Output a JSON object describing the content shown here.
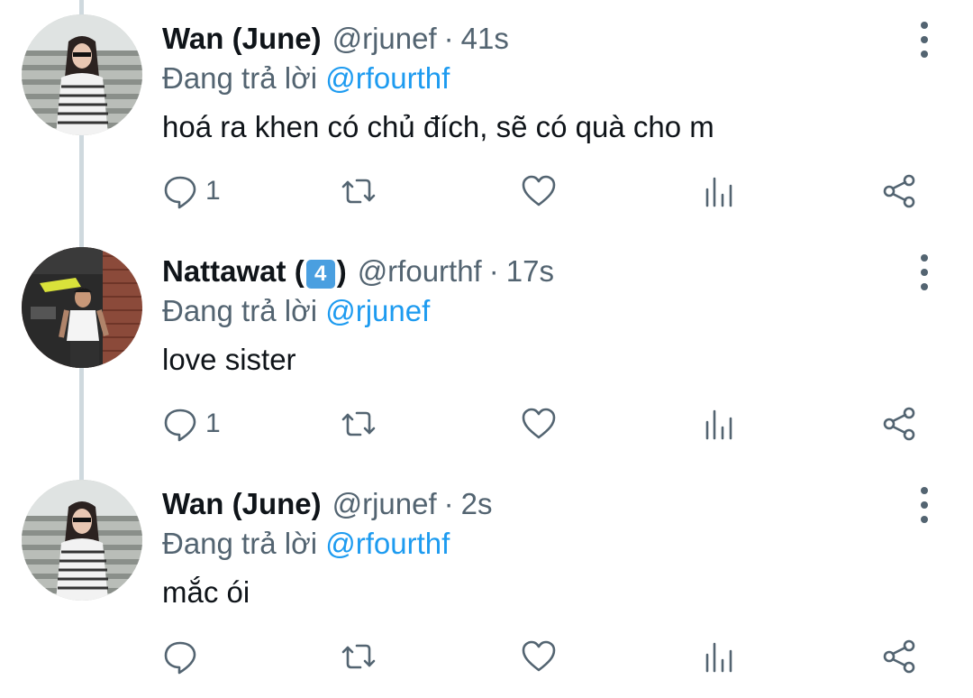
{
  "tweets": [
    {
      "name": "Wan (June)",
      "name_emoji": "",
      "name_suffix": "",
      "handle": "@rjunef",
      "separator": "·",
      "time": "41s",
      "replying_prefix": "Đang trả lời",
      "replying_to": "@rfourthf",
      "text": "hoá ra khen có chủ đích, sẽ có quà cho m",
      "reply_count": "1",
      "avatar": "woman-striped-shirt-stairs"
    },
    {
      "name": "Nattawat (",
      "name_emoji": "4",
      "name_suffix": ")",
      "handle": "@rfourthf",
      "separator": "·",
      "time": "17s",
      "replying_prefix": "Đang trả lời",
      "replying_to": "@rjunef",
      "text": "love sister",
      "reply_count": "1",
      "avatar": "man-white-tank-brick-wall"
    },
    {
      "name": "Wan (June)",
      "name_emoji": "",
      "name_suffix": "",
      "handle": "@rjunef",
      "separator": "·",
      "time": "2s",
      "replying_prefix": "Đang trả lời",
      "replying_to": "@rfourthf",
      "text": "mắc ói",
      "reply_count": "",
      "avatar": "woman-striped-shirt-stairs"
    }
  ],
  "icons": {
    "reply": "reply-icon",
    "retweet": "retweet-icon",
    "like": "like-icon",
    "analytics": "analytics-icon",
    "share": "share-icon",
    "more": "more-vertical-icon"
  },
  "colors": {
    "text": "#0f1419",
    "muted": "#536471",
    "link": "#1d9bf0",
    "thread_line": "#cfd9de"
  }
}
